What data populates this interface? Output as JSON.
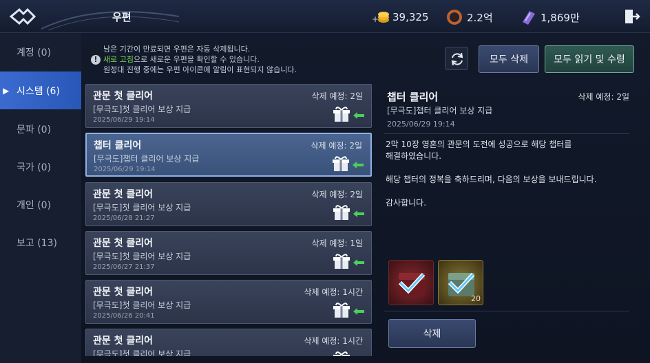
{
  "header": {
    "title": "우편",
    "currencies": [
      {
        "icon": "gold-coin-icon",
        "value": "39,325"
      },
      {
        "icon": "ring-icon",
        "value": "2.2억"
      },
      {
        "icon": "ticket-icon",
        "value": "1,869만"
      }
    ]
  },
  "sidebar": {
    "items": [
      {
        "label": "계정 (0)"
      },
      {
        "label": "시스템 (6)"
      },
      {
        "label": "문파 (0)"
      },
      {
        "label": "국가 (0)"
      },
      {
        "label": "개인 (0)"
      },
      {
        "label": "보고 (13)"
      }
    ],
    "active_index": 1
  },
  "notice": {
    "line1": "남은 기간이 만료되면 우편은 자동 삭제됩니다.",
    "line2_highlight": "새로 고침",
    "line2_rest": "으로 새로운 우편을 확인할 수 있습니다.",
    "line3": "원정대 진행 중에는 우편 아이콘에 알림이 표현되지 않습니다."
  },
  "actions": {
    "delete_all": "모두 삭제",
    "read_all": "모두 읽기 및 수령"
  },
  "mails": [
    {
      "title": "관문 첫 클리어",
      "sub": "[무극도]첫 클리어 보상 지급",
      "date": "2025/06/29 19:14",
      "expire": "삭제 예정: 2일"
    },
    {
      "title": "챕터 클리어",
      "sub": "[무극도]챕터 클리어 보상 지급",
      "date": "2025/06/29 19:14",
      "expire": "삭제 예정: 2일"
    },
    {
      "title": "관문 첫 클리어",
      "sub": "[무극도]첫 클리어 보상 지급",
      "date": "2025/06/28 21:27",
      "expire": "삭제 예정: 2일"
    },
    {
      "title": "관문 첫 클리어",
      "sub": "[무극도]첫 클리어 보상 지급",
      "date": "2025/06/27 21:37",
      "expire": "삭제 예정: 1일"
    },
    {
      "title": "관문 첫 클리어",
      "sub": "[무극도]첫 클리어 보상 지급",
      "date": "2025/06/26 20:41",
      "expire": "삭제 예정: 1시간"
    },
    {
      "title": "관문 첫 클리어",
      "sub": "[무극도]첫 클리어 보상 지급",
      "date": "",
      "expire": "삭제 예정: 1시간"
    }
  ],
  "selected_index": 1,
  "detail": {
    "title": "챕터 클리어",
    "expire": "삭제 예정: 2일",
    "sub": "[무극도]챕터 클리어 보상 지급",
    "date": "2025/06/29 19:14",
    "body": "2막 10장 영혼의 관문의 도전에 성공으로 해당 챕터를\n해결하였습니다.\n\n해당 챕터의 정복을 축하드리며, 다음의 보상을 보내드립니다.\n\n감사합니다.",
    "rewards": [
      {
        "icon": "red-chest-icon",
        "count": "",
        "color": "#5a1a1e"
      },
      {
        "icon": "gold-chest-icon",
        "count": "20",
        "color": "#5a4a1a"
      }
    ],
    "delete_label": "삭제"
  }
}
